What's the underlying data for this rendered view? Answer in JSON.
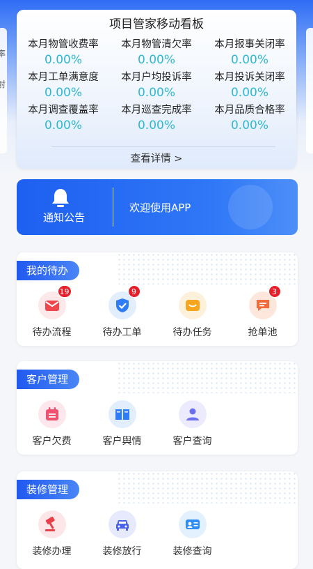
{
  "side": {
    "left_chars": [
      "率",
      "射"
    ]
  },
  "kpi": {
    "title": "项目管家移动看板",
    "items": [
      {
        "label": "本月物管收费率",
        "value": "0.00%"
      },
      {
        "label": "本月物管清欠率",
        "value": "0.00%"
      },
      {
        "label": "本月报事关闭率",
        "value": "0.00%"
      },
      {
        "label": "本月工单满意度",
        "value": "0.00%"
      },
      {
        "label": "本月户均投诉率",
        "value": "0.00%"
      },
      {
        "label": "本月投诉关闭率",
        "value": "0.00%"
      },
      {
        "label": "本月调查覆盖率",
        "value": "0.00%"
      },
      {
        "label": "本月巡查完成率",
        "value": "0.00%"
      },
      {
        "label": "本月品质合格率",
        "value": "0.00%"
      }
    ],
    "detail_link": "查看详情 >"
  },
  "notice": {
    "label": "通知公告",
    "text": "欢迎使用APP",
    "icon": "bell-icon"
  },
  "todo": {
    "title": "我的待办",
    "items": [
      {
        "label": "待办流程",
        "badge": "19",
        "icon": "mail-icon",
        "color": "#f0464e"
      },
      {
        "label": "待办工单",
        "badge": "9",
        "icon": "shield-check-icon",
        "color": "#2f7df6"
      },
      {
        "label": "待办任务",
        "badge": "",
        "icon": "inbox-icon",
        "color": "#f6a51e"
      },
      {
        "label": "抢单池",
        "badge": "3",
        "icon": "chat-icon",
        "color": "#f26b3a"
      }
    ]
  },
  "customer": {
    "title": "客户管理",
    "items": [
      {
        "label": "客户欠费",
        "icon": "calendar-icon",
        "color": "#f0506f"
      },
      {
        "label": "客户舆情",
        "icon": "book-icon",
        "color": "#2f7df6"
      },
      {
        "label": "客户查询",
        "icon": "user-card-icon",
        "color": "#6b6ff0"
      }
    ]
  },
  "decoration": {
    "title": "装修管理",
    "items": [
      {
        "label": "装修办理",
        "icon": "hammer-icon",
        "color": "#e8404a"
      },
      {
        "label": "装修放行",
        "icon": "car-icon",
        "color": "#4b63e8"
      },
      {
        "label": "装修查询",
        "icon": "id-card-icon",
        "color": "#2f8df6"
      }
    ]
  }
}
